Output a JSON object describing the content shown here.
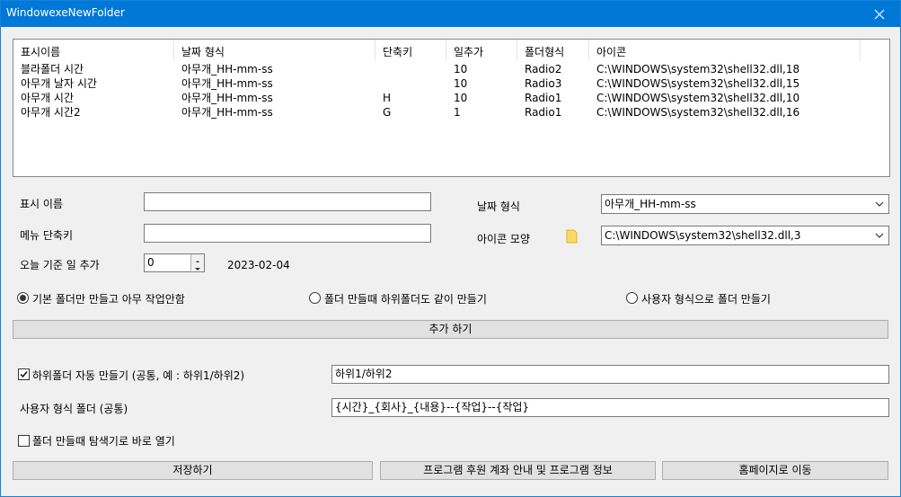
{
  "window": {
    "title": "WindowexeNewFolder"
  },
  "list": {
    "columns": [
      "표시이름",
      "날짜 형식",
      "단축키",
      "일추가",
      "폴더형식",
      "아이콘"
    ],
    "rows": [
      [
        "블라폴더 시간",
        "아무개_HH-mm-ss",
        "",
        "10",
        "Radio2",
        "C:\\WINDOWS\\system32\\shell32.dll,18"
      ],
      [
        "아무개 날자 시간",
        "아무개_HH-mm-ss",
        "",
        "10",
        "Radio3",
        "C:\\WINDOWS\\system32\\shell32.dll,15"
      ],
      [
        "아무개 시간",
        "아무개_HH-mm-ss",
        "H",
        "10",
        "Radio1",
        "C:\\WINDOWS\\system32\\shell32.dll,10"
      ],
      [
        "아무개 시간2",
        "아무개_HH-mm-ss",
        "G",
        "1",
        "Radio1",
        "C:\\WINDOWS\\system32\\shell32.dll,16"
      ]
    ]
  },
  "form": {
    "display_name_label": "표시 이름",
    "display_name_value": "",
    "shortcut_label": "메뉴 단축키",
    "shortcut_value": "",
    "days_label": "오늘 기준 일 추가",
    "days_value": "0",
    "date_preview": "2023-02-04",
    "date_format_label": "날짜 형식",
    "date_format_value": "아무개_HH-mm-ss",
    "icon_label": "아이콘 모양",
    "icon_value": "C:\\WINDOWS\\system32\\shell32.dll,3"
  },
  "radios": [
    {
      "label": "기본 폴더만 만들고 아무 작업안함",
      "checked": true
    },
    {
      "label": "폴더 만들때 하위폴더도 같이 만들기",
      "checked": false
    },
    {
      "label": "사용자 형식으로 폴더 만들기",
      "checked": false
    }
  ],
  "add_button": "추가 하기",
  "subfolder": {
    "checkbox_label": "하위폴더 자동 만들기 (공통, 예 : 하위1/하위2)",
    "checked": true,
    "value": "하위1/하위2"
  },
  "custom_format": {
    "label": "사용자 형식 폴더 (공통)",
    "value": "{시간}_{회사}_{내용}--{작업}--{작업}"
  },
  "open_explorer": {
    "label": "폴더 만들때 탐색기로 바로 열기",
    "checked": false
  },
  "bottom_buttons": {
    "save": "저장하기",
    "info": "프로그램 후원 계좌 안내 및 프로그램 정보",
    "homepage": "홈페이지로 이동"
  },
  "colors": {
    "titlebar": "#0078d7",
    "background": "#f0f0f0",
    "folder_icon": "#ffd966"
  }
}
